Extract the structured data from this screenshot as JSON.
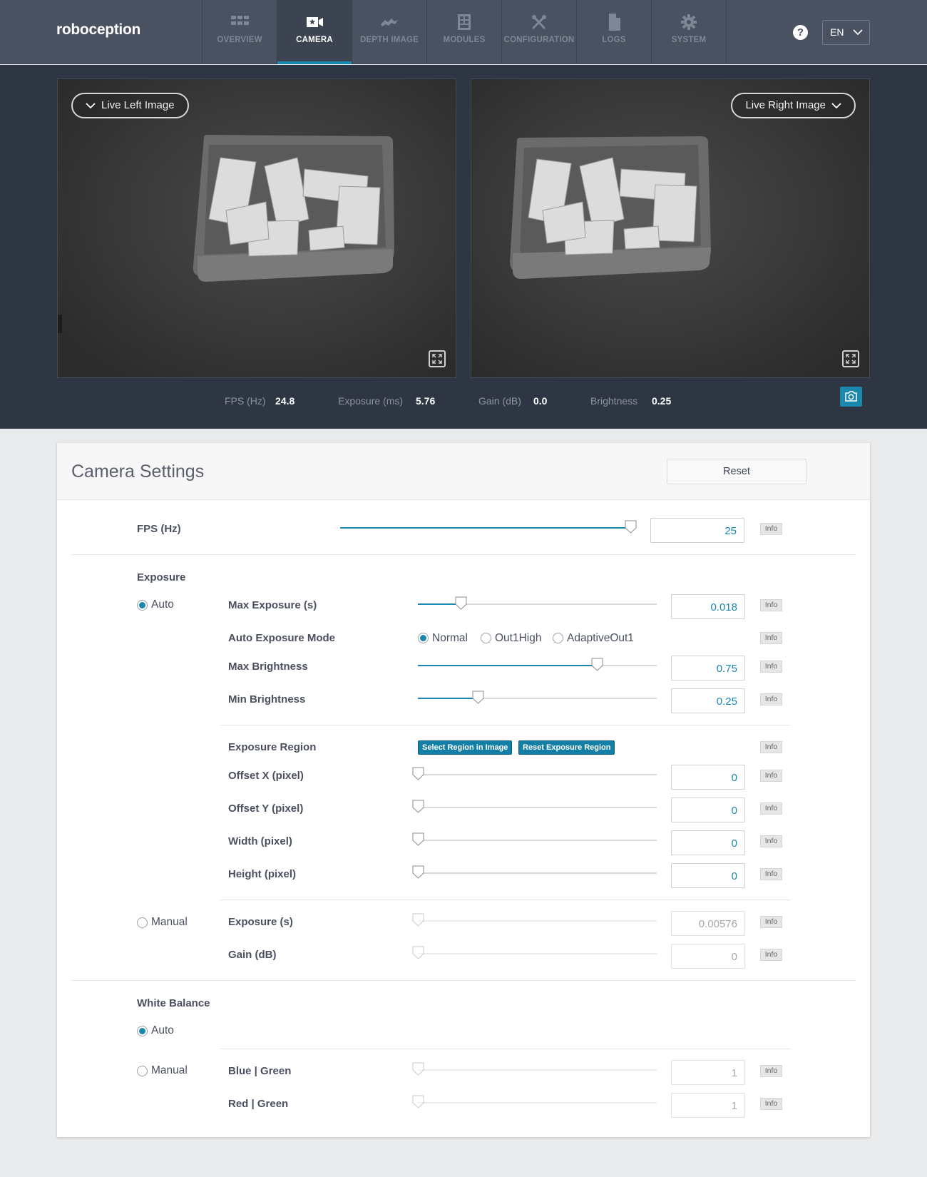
{
  "app": {
    "logo": "roboception"
  },
  "nav": {
    "tabs": [
      {
        "label": "OVERVIEW",
        "icon": "grid-icon",
        "active": false
      },
      {
        "label": "CAMERA",
        "icon": "camera-icon",
        "active": true
      },
      {
        "label": "DEPTH IMAGE",
        "icon": "depth-icon",
        "active": false
      },
      {
        "label": "MODULES",
        "icon": "modules-icon",
        "active": false
      },
      {
        "label": "CONFIGURATION",
        "icon": "tools-icon",
        "active": false
      },
      {
        "label": "LOGS",
        "icon": "document-icon",
        "active": false
      },
      {
        "label": "SYSTEM",
        "icon": "gear-icon",
        "active": false
      }
    ],
    "help": "?",
    "language": "EN"
  },
  "viewer": {
    "left_select": "Live Left Image",
    "right_select": "Live Right Image",
    "stats": {
      "fps_label": "FPS (Hz)",
      "fps_value": "24.8",
      "exposure_label": "Exposure (ms)",
      "exposure_value": "5.76",
      "gain_label": "Gain (dB)",
      "gain_value": "0.0",
      "brightness_label": "Brightness",
      "brightness_value": "0.25"
    }
  },
  "settings": {
    "title": "Camera Settings",
    "reset": "Reset",
    "info": "Info",
    "fps": {
      "label": "FPS (Hz)",
      "value": "25",
      "level": 0.98
    },
    "exposure": {
      "section": "Exposure",
      "auto_label": "Auto",
      "manual_label": "Manual",
      "max_exposure": {
        "label": "Max Exposure (s)",
        "value": "0.018",
        "level": 0.18
      },
      "mode": {
        "label": "Auto Exposure Mode",
        "options": [
          "Normal",
          "Out1High",
          "AdaptiveOut1"
        ],
        "selected": "Normal"
      },
      "max_brightness": {
        "label": "Max Brightness",
        "value": "0.75",
        "level": 0.75
      },
      "min_brightness": {
        "label": "Min Brightness",
        "value": "0.25",
        "level": 0.25
      },
      "region": {
        "label": "Exposure Region",
        "select_btn": "Select Region in Image",
        "reset_btn": "Reset Exposure Region"
      },
      "offset_x": {
        "label": "Offset X (pixel)",
        "value": "0",
        "level": 0
      },
      "offset_y": {
        "label": "Offset Y (pixel)",
        "value": "0",
        "level": 0
      },
      "width": {
        "label": "Width (pixel)",
        "value": "0",
        "level": 0
      },
      "height": {
        "label": "Height (pixel)",
        "value": "0",
        "level": 0
      },
      "manual_exposure": {
        "label": "Exposure (s)",
        "value": "0.00576",
        "level": 0
      },
      "manual_gain": {
        "label": "Gain (dB)",
        "value": "0",
        "level": 0
      }
    },
    "white_balance": {
      "section": "White Balance",
      "auto_label": "Auto",
      "manual_label": "Manual",
      "blue_green": {
        "label": "Blue | Green",
        "value": "1",
        "level": 0
      },
      "red_green": {
        "label": "Red | Green",
        "value": "1",
        "level": 0
      }
    }
  },
  "colors": {
    "accent": "#1a87ad",
    "nav_bg": "#4a5262",
    "viewer_bg": "#2f3643"
  }
}
